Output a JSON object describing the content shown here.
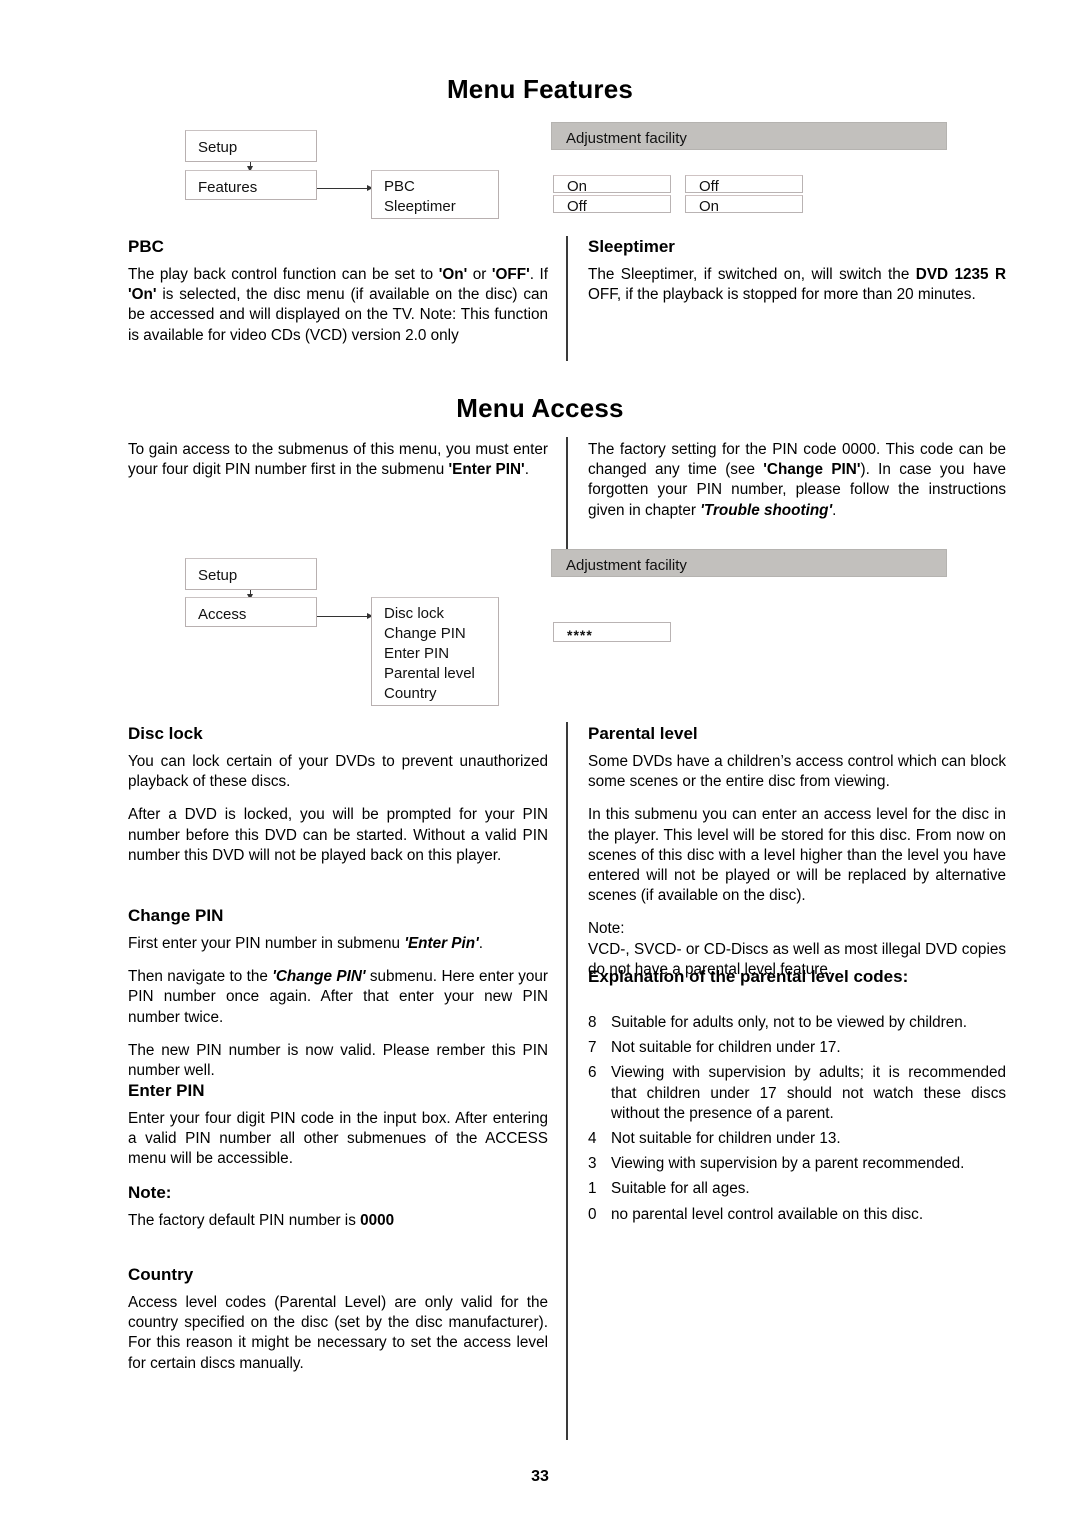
{
  "page": {
    "number": "33",
    "background": "#ffffff",
    "accent_gray": "#c2c0bd",
    "border_gray": "#b8b0b0"
  },
  "sections": {
    "features": {
      "title": "Menu Features",
      "diagram": {
        "nodes": {
          "setup": "Setup",
          "features": "Features"
        },
        "submenu": [
          "PBC",
          "Sleeptimer"
        ],
        "adjustment_label": "Adjustment facility",
        "options": {
          "row1": [
            "On",
            "Off"
          ],
          "row2": [
            "Off",
            "On"
          ]
        }
      },
      "left": {
        "heading": "PBC",
        "paragraph_parts": {
          "p1_a": "The play back control function can be set to ",
          "p1_on": "'On'",
          "p1_b": " or ",
          "p1_off": "'OFF'",
          "p1_c": ". If ",
          "p1_on2": "'On'",
          "p1_d": " is selected, the disc menu (if available on the disc) can be accessed and will displayed on the TV. Note: This function is available for video CDs (VCD) version 2.0 only"
        }
      },
      "right": {
        "heading": "Sleeptimer",
        "paragraph_parts": {
          "p1_a": "The Sleeptimer, if switched on, will switch the ",
          "p1_model": "DVD 1235 R",
          "p1_b": " OFF, if the playback is stopped for more than 20 minutes."
        }
      }
    },
    "access": {
      "title": "Menu Access",
      "intro_left": {
        "a": "To gain access to the submenus of this menu, you must enter your four digit PIN number first in the submenu ",
        "enter_pin": "'Enter PIN'",
        "b": "."
      },
      "intro_right": {
        "a": "The factory setting for the PIN code 0000. This code can be changed any time (see ",
        "change_pin": "'Change PIN'",
        "b": "). In case you have forgotten your PIN number, please follow the instructions given in chapter ",
        "trouble": "'Trouble shooting'",
        "c": "."
      },
      "diagram": {
        "nodes": {
          "setup": "Setup",
          "access": "Access"
        },
        "submenu": [
          "Disc lock",
          "Change PIN",
          "Enter PIN",
          "Parental level",
          "Country"
        ],
        "adjustment_label": "Adjustment facility",
        "pin_value": "****"
      },
      "disc_lock": {
        "heading": "Disc lock",
        "p1": "You can lock certain of your DVDs to prevent unauthorized playback of these discs.",
        "p2": "After a DVD is locked, you will be prompted for your PIN number before this DVD can be started. Without a valid PIN number this DVD will not be played back on this player."
      },
      "change_pin": {
        "heading": "Change PIN",
        "p1_a": "First enter your PIN number in submenu ",
        "p1_enter_pin": "'Enter Pin'",
        "p1_b": ".",
        "p2_a": "Then navigate to the ",
        "p2_change_pin": "'Change PIN'",
        "p2_b": " submenu. Here enter your PIN number once again. After that enter your new PIN number twice.",
        "p3": "The new PIN number is now valid. Please rember this PIN number well."
      },
      "enter_pin": {
        "heading": "Enter PIN",
        "p1": "Enter your four digit PIN code in the input box. After entering a valid PIN number all other submenues of the ACCESS menu will be accessible."
      },
      "note_left": {
        "heading": "Note:",
        "p1_a": "The factory default PIN number is ",
        "p1_code": "0000"
      },
      "country": {
        "heading": "Country",
        "p1": "Access level codes (Parental Level) are only valid for the country specified on the disc (set by the disc manufacturer). For this reason it might be necessary to set the access level for certain discs manually."
      },
      "parental_level": {
        "heading": "Parental level",
        "p1": "Some DVDs have a children’s access control which can block some scenes or the entire disc from viewing.",
        "p2": "In this submenu you can enter an access level for the disc in the player. This level will be stored for this disc. From now on scenes of this disc with a level higher than the level you have entered will not be played or will be replaced by alternative scenes (if available on the disc).",
        "note_label": "Note:",
        "note_text": "VCD-, SVCD- or CD-Discs as well as most illegal DVD copies do not have a parental level feature."
      },
      "codes": {
        "heading": "Explanation of the parental level codes:",
        "items": [
          {
            "num": "8",
            "text": "Suitable for adults only, not to be viewed by children."
          },
          {
            "num": "7",
            "text": "Not suitable for children under 17."
          },
          {
            "num": "6",
            "text": "Viewing with supervision by adults; it is recommended that children under 17 should not watch these discs without the presence of a parent."
          },
          {
            "num": "4",
            "text": "Not suitable for children under 13."
          },
          {
            "num": "3",
            "text": "Viewing with supervision by a parent recommended."
          },
          {
            "num": "1",
            "text": "Suitable for all ages."
          },
          {
            "num": "0",
            "text": "no parental level control available on this disc."
          }
        ]
      }
    }
  }
}
